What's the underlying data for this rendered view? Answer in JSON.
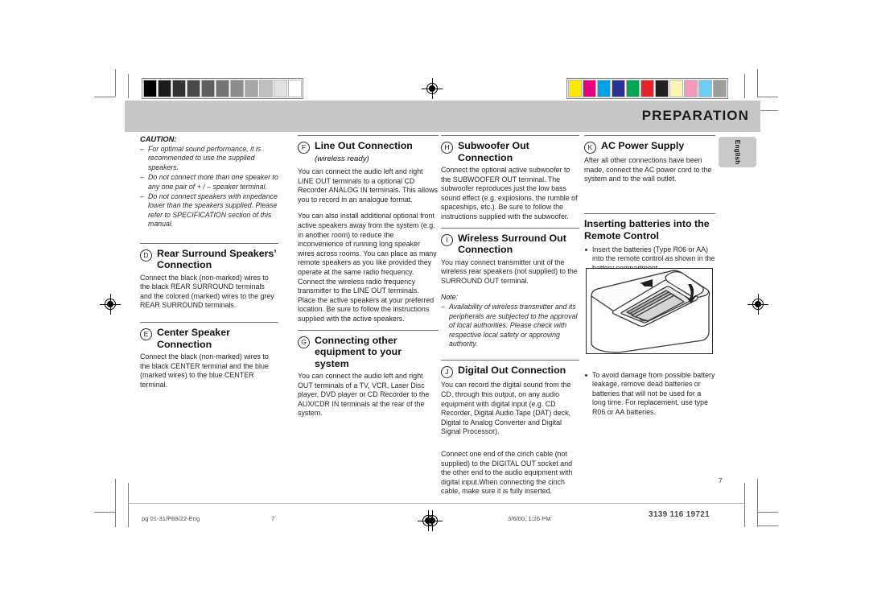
{
  "header": {
    "title": "PREPARATION",
    "language_tab": "English"
  },
  "colorbar": {
    "grayscale": [
      "#000000",
      "#1c1c1c",
      "#333333",
      "#4a4a4a",
      "#5f5f5f",
      "#757575",
      "#8c8c8c",
      "#a6a6a6",
      "#c0c0c0",
      "#e2e2e2",
      "#ffffff"
    ],
    "colors": [
      "#ffe800",
      "#e5007e",
      "#00a0e9",
      "#2b3192",
      "#00a650",
      "#e8222a",
      "#231f20",
      "#fbf3b0",
      "#f49ac1",
      "#6dcff6",
      "#9d9d9d"
    ]
  },
  "columns": {
    "col1": {
      "caution": {
        "title": "CAUTION:",
        "items": [
          "For optimal sound performance, it is recommended to use the supplied speakers.",
          "Do not connect more than one speaker to any one pair of + / –  speaker terminal.",
          "Do not connect speakers with impedance lower than the speakers supplied.  Please refer to SPECIFICATION section of this manual."
        ]
      },
      "section_d": {
        "letter": "D",
        "title": "Rear Surround Speakers’ Connection",
        "paragraphs": [
          "Connect the black (non-marked) wires to the black REAR SURROUND terminals and the colored (marked) wires to the grey REAR SURROUND terminals."
        ]
      },
      "section_e": {
        "letter": "E",
        "title": "Center Speaker Connection",
        "paragraphs": [
          "Connect the black (non-marked) wires to the black CENTER terminal and the blue (marked wires) to the blue CENTER terminal."
        ]
      }
    },
    "col2": {
      "section_f": {
        "letter": "F",
        "title": "Line Out Connection",
        "title_italic": "(wireless ready)",
        "paragraphs": [
          "You can connect the audio left and right LINE OUT terminals to a optional CD Recorder ANALOG IN terminals. This allows you to record in an analogue format.",
          "You can also install additional optional front active speakers away from the system (e.g. in another room) to reduce the inconvenience of running long speaker wires across rooms. You can place as many remote speakers as you like provided they operate at the same radio frequency. Connect the wireless radio frequency transmitter to the LINE OUT terminals. Place the active speakers at your preferred location. Be sure to follow the instructions supplied with the active speakers."
        ]
      },
      "section_g": {
        "letter": "G",
        "title": "Connecting other equipment to your system",
        "paragraphs": [
          "You can connect the audio left and right OUT terminals of a  TV, VCR, Laser Disc player, DVD player or CD Recorder to the AUX/CDR IN terminals at the rear of the system."
        ]
      }
    },
    "col3": {
      "section_h": {
        "letter": "H",
        "title": "Subwoofer Out Connection",
        "paragraphs": [
          "Connect the optional active subwoofer to the SUBWOOFER OUT terminal. The subwoofer reproduces just the low bass sound effect (e.g. explosions, the rumble of spaceships, etc.). Be sure to follow the instructions supplied with the subwoofer."
        ]
      },
      "section_i": {
        "letter": "I",
        "title": "Wireless Surround Out Connection",
        "paragraphs": [
          "You may connect transmitter unit of the wireless rear speakers (not supplied) to the SURROUND OUT terminal."
        ],
        "note_title": "Note:",
        "note_items": [
          "Availability of wireless transmitter and its peripherals are subjected to the approval of local authorities. Please check with respective local safety or approving authority."
        ]
      },
      "section_j": {
        "letter": "J",
        "title": "Digital Out Connection",
        "paragraphs": [
          "You can record the digital sound from the CD, through this output, on any audio equipment with digital input (e.g. CD Recorder, Digital Audio Tape (DAT) deck, Digital to Analog Converter and Digital Signal Processor).",
          "Connect one end of the cinch cable (not supplied) to the DIGITAL OUT socket and the other end to the audio equipment with digital input.When connecting the cinch cable, make sure it is fully inserted."
        ]
      }
    },
    "col4": {
      "section_k": {
        "letter": "K",
        "title": "AC Power Supply",
        "paragraphs": [
          "After all other connections have been made, connect the AC power cord to the system and to the wall outlet."
        ]
      },
      "batteries": {
        "title": "Inserting batteries into the Remote Control",
        "bullets_before": [
          "Insert the batteries  (Type R06 or AA) into the remote control as shown in the battery compartment."
        ],
        "illustration": "remote-control-battery-compartment",
        "bullets_after": [
          "To avoid damage from possible battery leakage, remove dead batteries or batteries that will not be used for a long time. For replacement, use type R06 or AA batteries."
        ]
      }
    }
  },
  "footer": {
    "file": "pg 01-31/P88/22-Eng",
    "page_left": "7",
    "timestamp": "3/6/00, 1:26 PM",
    "code": "3139 116 19721",
    "page_number": "7"
  }
}
